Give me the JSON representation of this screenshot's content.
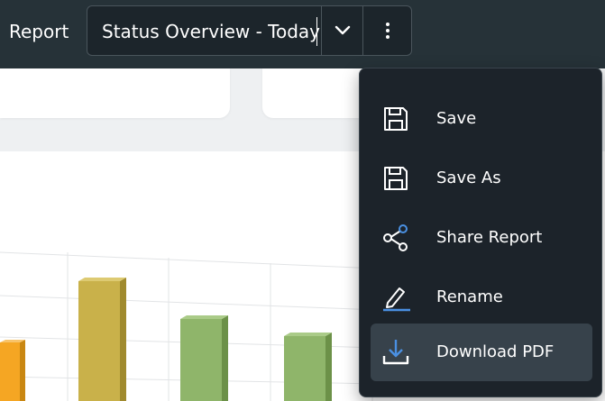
{
  "header": {
    "report_label": "Report",
    "report_title": "Status Overview - Today",
    "dropdown_icon": "chevron-down-icon",
    "more_icon": "kebab-menu-icon"
  },
  "menu": {
    "items": [
      {
        "label": "Save",
        "icon": "save-icon"
      },
      {
        "label": "Save As",
        "icon": "save-as-icon"
      },
      {
        "label": "Share Report",
        "icon": "share-icon"
      },
      {
        "label": "Rename",
        "icon": "rename-icon"
      },
      {
        "label": "Download PDF",
        "icon": "download-icon",
        "highlighted": true
      }
    ]
  },
  "colors": {
    "topbar": "#263238",
    "menu_bg": "#1c232a",
    "menu_hover": "#37424b",
    "icon_accent": "#4a90e2"
  },
  "chart_data": {
    "type": "bar",
    "visible": "partial",
    "bars": [
      {
        "color": "#f5a623"
      },
      {
        "color": "#c9b14a"
      },
      {
        "color": "#8fb56a"
      },
      {
        "color": "#8fb56a"
      }
    ]
  }
}
